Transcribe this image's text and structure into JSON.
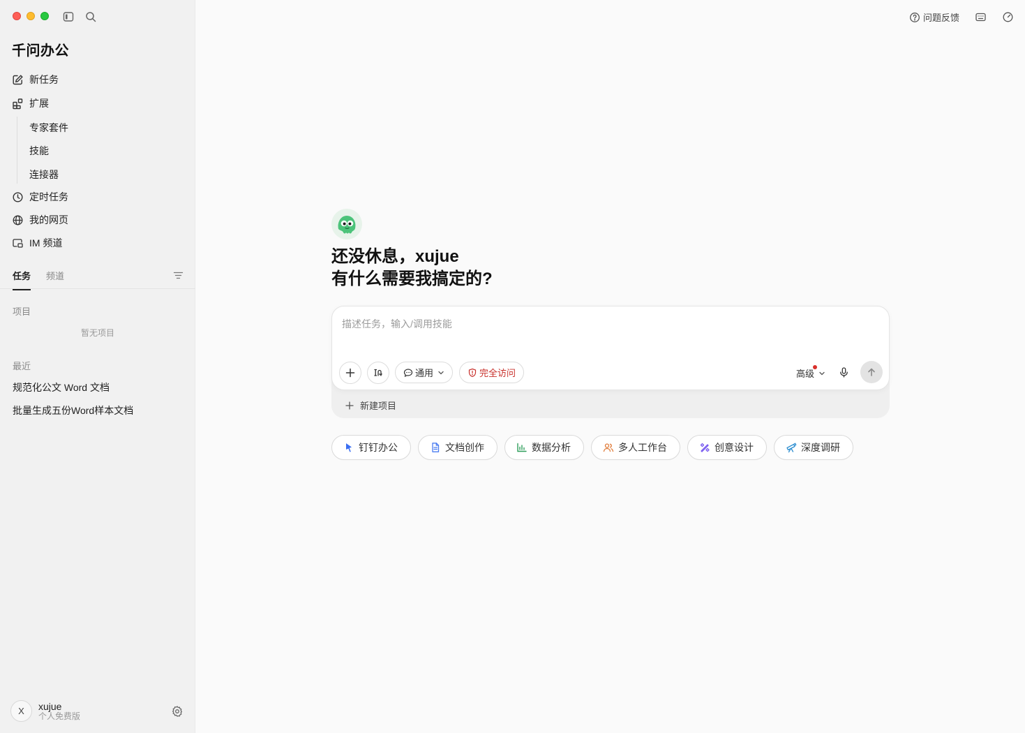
{
  "app": {
    "title": "千问办公"
  },
  "sidebar": {
    "nav": [
      {
        "label": "新任务",
        "icon": "edit-icon"
      },
      {
        "label": "扩展",
        "icon": "extensions-icon"
      }
    ],
    "sub_items": [
      "专家套件",
      "技能",
      "连接器"
    ],
    "nav2": [
      {
        "label": "定时任务",
        "icon": "clock-icon"
      },
      {
        "label": "我的网页",
        "icon": "globe-icon"
      },
      {
        "label": "IM 频道",
        "icon": "im-channel-icon"
      }
    ],
    "tabs": [
      "任务",
      "频道"
    ],
    "projects_label": "项目",
    "projects_empty": "暂无项目",
    "recent_label": "最近",
    "recent": [
      "规范化公文 Word 文档",
      "批量生成五份Word样本文档"
    ],
    "user": {
      "initial": "X",
      "name": "xujue",
      "plan": "个人免费版"
    }
  },
  "header": {
    "feedback": "问题反馈"
  },
  "main": {
    "greeting_line1": "还没休息，xujue",
    "greeting_line2": "有什么需要我搞定的?",
    "composer": {
      "placeholder": "描述任务，输入/调用技能",
      "mode": "通用",
      "access": "完全访问",
      "advanced": "高级",
      "new_project": "新建项目"
    },
    "chips": [
      {
        "label": "钉钉办公",
        "icon": "dingtalk-icon",
        "color": "#3b6ff2"
      },
      {
        "label": "文档创作",
        "icon": "document-icon",
        "color": "#4a7cf0"
      },
      {
        "label": "数据分析",
        "icon": "bar-chart-icon",
        "color": "#2f9e5b"
      },
      {
        "label": "多人工作台",
        "icon": "people-icon",
        "color": "#e07b39"
      },
      {
        "label": "创意设计",
        "icon": "design-icon",
        "color": "#7a5cf0"
      },
      {
        "label": "深度调研",
        "icon": "telescope-icon",
        "color": "#2f8fd1"
      }
    ]
  },
  "colors": {
    "accent_red": "#c8302b",
    "sidebar_bg": "#f1f1f1",
    "main_bg": "#fafafa"
  }
}
